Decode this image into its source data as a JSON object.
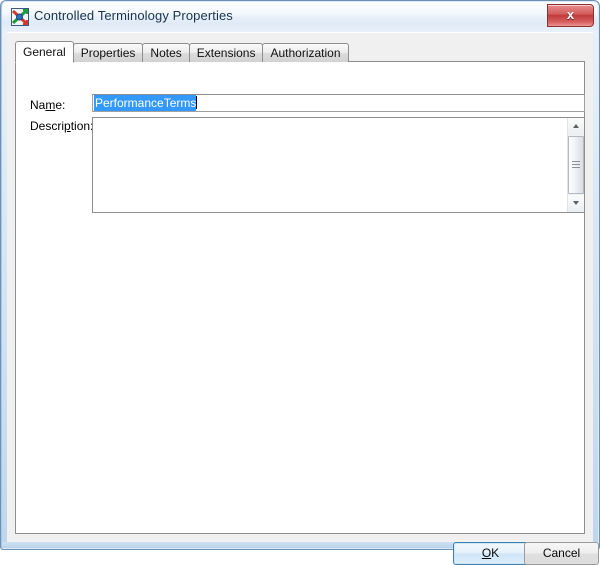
{
  "window": {
    "title": "Controlled Terminology Properties",
    "icon": "app-icon",
    "close_label": "x"
  },
  "tabs": [
    {
      "label": "General",
      "selected": true
    },
    {
      "label": "Properties",
      "selected": false
    },
    {
      "label": "Notes",
      "selected": false
    },
    {
      "label": "Extensions",
      "selected": false
    },
    {
      "label": "Authorization",
      "selected": false
    }
  ],
  "form": {
    "name_label_pre": "Na",
    "name_label_mnemonic": "m",
    "name_label_post": "e:",
    "name_value": "PerformanceTerms",
    "name_placeholder": "",
    "desc_label_pre": "Descri",
    "desc_label_mnemonic": "p",
    "desc_label_post": "tion:",
    "desc_value": "",
    "desc_placeholder": ""
  },
  "scrollbar": {
    "up_icon": "scroll-up-arrow",
    "down_icon": "scroll-down-arrow",
    "thumb_icon": "scroll-thumb-grip"
  },
  "buttons": {
    "ok_pre": "",
    "ok_mnemonic": "O",
    "ok_post": "K",
    "cancel_label": "Cancel"
  },
  "colors": {
    "selection": "#3399ff",
    "accent": "#3c7fb1",
    "close": "#bf3b3b",
    "frame": "#d4e4f5"
  }
}
